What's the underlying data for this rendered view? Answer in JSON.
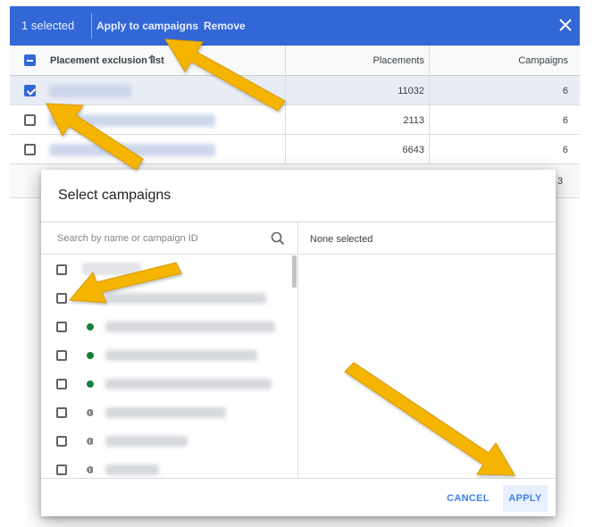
{
  "selection_bar": {
    "count_text": "1 selected",
    "apply_label": "Apply to campaigns",
    "remove_label": "Remove",
    "close_icon": "close-icon",
    "color": "#3367d6"
  },
  "table": {
    "columns": [
      "Placement exclusion list",
      "Placements",
      "Campaigns"
    ],
    "sort_icon": "arrow-up-icon",
    "rows": [
      {
        "placements": "11032",
        "campaigns": "6",
        "selected": true
      },
      {
        "placements": "2113",
        "campaigns": "6",
        "selected": false
      },
      {
        "placements": "6643",
        "campaigns": "6",
        "selected": false
      }
    ],
    "partial_row_value": "3"
  },
  "dialog": {
    "title": "Select campaigns",
    "search_placeholder": "Search by name or campaign ID",
    "search_icon": "search-icon",
    "right_header": "None selected",
    "campaign_items": [
      {
        "status": "none"
      },
      {
        "status": "none"
      },
      {
        "status": "enabled"
      },
      {
        "status": "enabled"
      },
      {
        "status": "enabled"
      },
      {
        "status": "paused"
      },
      {
        "status": "paused"
      },
      {
        "status": "paused"
      }
    ],
    "cancel_label": "CANCEL",
    "apply_label": "APPLY",
    "status_colors": {
      "enabled": "#188038",
      "paused": "#80868b"
    }
  },
  "annotations": {
    "arrow_color": "#f4b400"
  }
}
